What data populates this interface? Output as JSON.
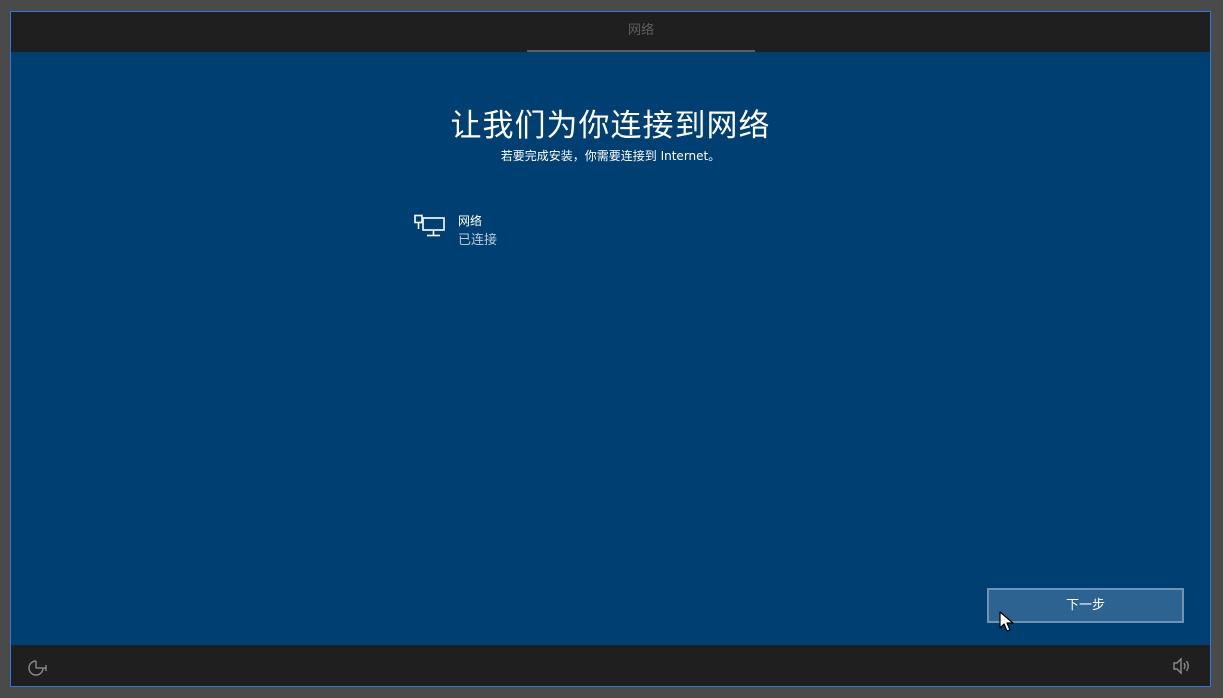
{
  "topbar": {
    "tab_label": "网络"
  },
  "main": {
    "heading": "让我们为你连接到网络",
    "subheading": "若要完成安装，你需要连接到 Internet。",
    "network": {
      "name": "网络",
      "status": "已连接",
      "icon": "wired-network-icon"
    },
    "next_label": "下一步"
  },
  "bottombar": {
    "left_icon": "ease-of-access-icon",
    "right_icon": "volume-icon"
  },
  "colors": {
    "background": "#003f72",
    "bar": "#1f1f1f",
    "button": "#2c6390",
    "button_border": "#6f94b3",
    "frame_border": "#2a7ad8"
  }
}
